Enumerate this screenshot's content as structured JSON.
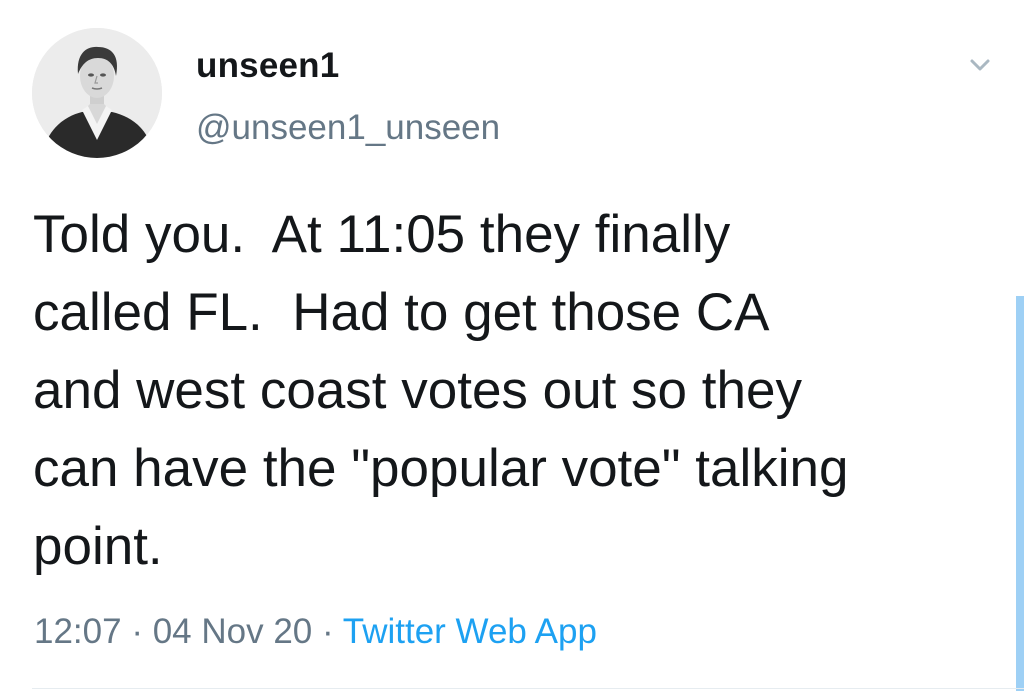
{
  "tweet": {
    "author": {
      "display_name": "unseen1",
      "handle": "@unseen1_unseen"
    },
    "text": "Told you.  At 11:05 they finally\ncalled FL.  Had to get those CA\nand west coast votes out so they\ncan have the \"popular vote\" talking\npoint.",
    "time": "12:07",
    "date": "04 Nov 20",
    "separator": " · ",
    "source": "Twitter Web App"
  },
  "icons": {
    "caret": "chevron-down-icon"
  },
  "colors": {
    "text": "#14171a",
    "secondary": "#657786",
    "link": "#1da1f2",
    "caret": "#aab8c2"
  }
}
